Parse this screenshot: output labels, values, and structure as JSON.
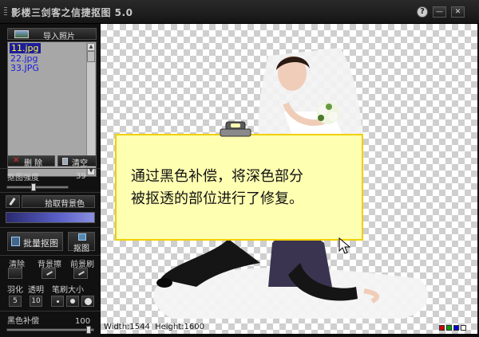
{
  "window": {
    "title": "影楼三剑客之信捷抠图 5.0",
    "help_label": "?",
    "minimize_label": "—",
    "close_label": "✕"
  },
  "left_panel": {
    "import_label": "导入照片",
    "files": [
      "11.jpg",
      "22.jpg",
      "33.JPG"
    ],
    "selected_file": "11.jpg",
    "delete_label": "删 除",
    "clear_label": "清空",
    "strength_label": "抠图强度",
    "strength_value": "39",
    "pick_bg_label": "拾取背景色",
    "pick_color": "#5a60c8",
    "batch_label": "批量抠图",
    "cutout_label": "抠图",
    "clear_tool_label": "清除",
    "bg_eraser_label": "背景擦",
    "fg_brush_label": "前景刷",
    "feather_label": "羽化",
    "feather_value": "5",
    "transparency_label": "透明",
    "transparency_value": "10",
    "brush_size_label": "笔刷大小",
    "black_comp_label": "黑色补偿",
    "black_comp_value": "100"
  },
  "canvas": {
    "width_label": "Width:1544",
    "height_label": "Height:1600",
    "swatches": [
      "#d00000",
      "#00a000",
      "#0000d0",
      "#ffffff"
    ]
  },
  "note": {
    "line1": "通过黑色补偿，将深色部分",
    "line2": "被抠透的部位进行了修复。"
  }
}
